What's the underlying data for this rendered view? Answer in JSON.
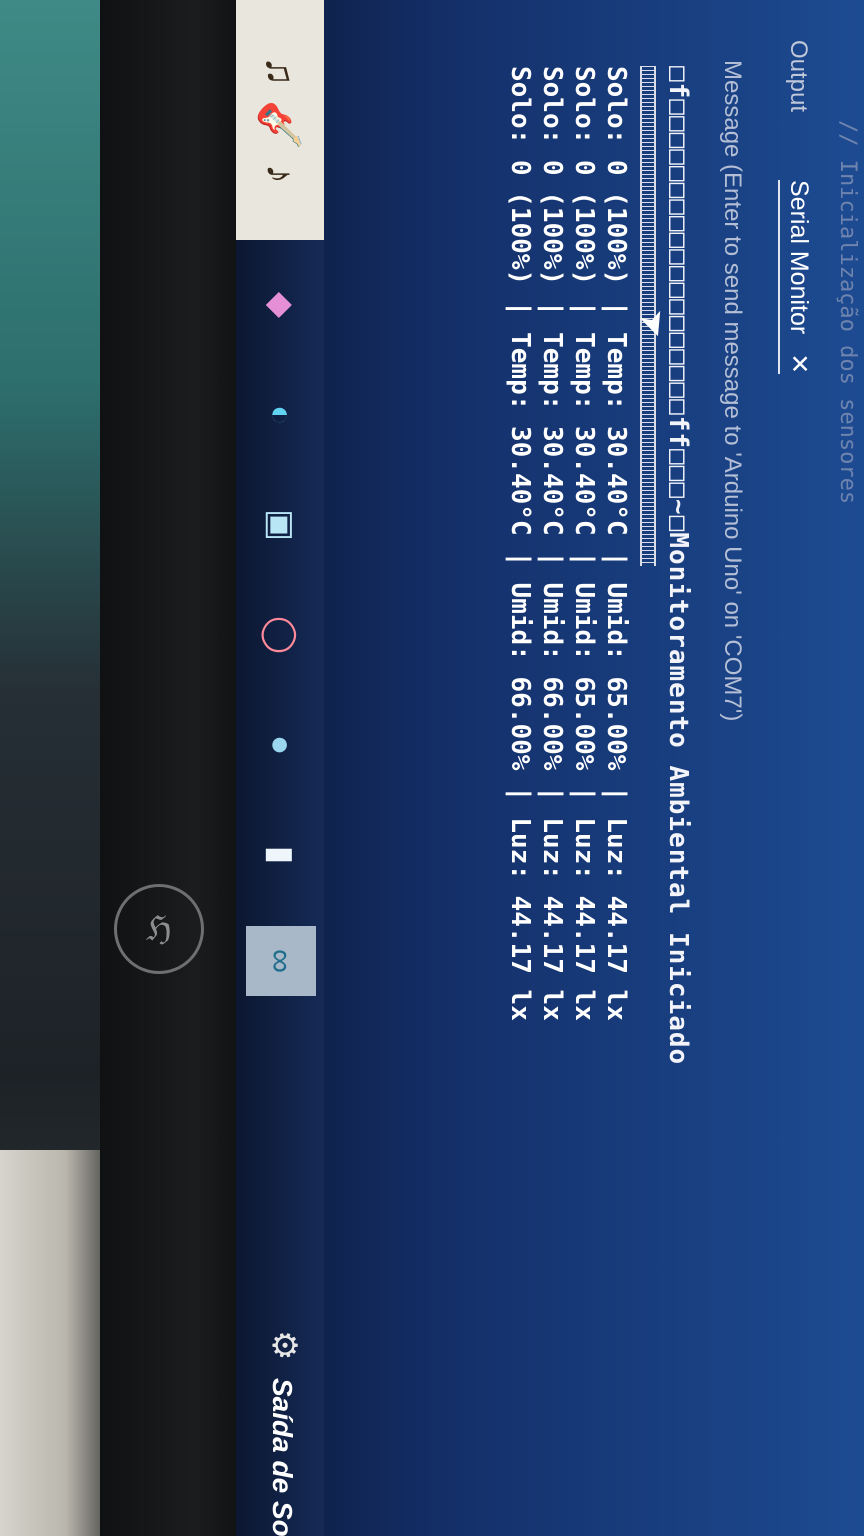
{
  "editor": {
    "code_comment": "// Inicialização dos sensores"
  },
  "panel": {
    "tabs": [
      {
        "label": "Output"
      },
      {
        "label": "Serial Monitor"
      }
    ],
    "close_symbol": "✕",
    "message_placeholder": "Message (Enter to send message to 'Arduino Uno' on 'COM7')"
  },
  "serial": {
    "garbled_header": "□f□□□□□□□□□□□□□□□□□□□ff□□□~□Monitoramento Ambiental Iniciado",
    "lines": [
      "Solo: 0 (100%) | Temp: 30.40°C | Umid: 65.00% | Luz: 44.17 lx",
      "Solo: 0 (100%) | Temp: 30.40°C | Umid: 65.00% | Luz: 44.17 lx",
      "Solo: 0 (100%) | Temp: 30.40°C | Umid: 66.00% | Luz: 44.17 lx",
      "Solo: 0 (100%) | Temp: 30.40°C | Umid: 66.00% | Luz: 44.17 lx"
    ]
  },
  "taskbar": {
    "tray_label": "Saída de Son",
    "icons": [
      {
        "name": "music-app-icon",
        "glyph": "♪"
      },
      {
        "name": "copilot-icon",
        "glyph": "◆"
      },
      {
        "name": "edge-icon",
        "glyph": "◐"
      },
      {
        "name": "store-icon",
        "glyph": "▣"
      },
      {
        "name": "opera-icon",
        "glyph": "◯"
      },
      {
        "name": "chrome-icon",
        "glyph": "●"
      },
      {
        "name": "file-explorer-icon",
        "glyph": "▮"
      },
      {
        "name": "arduino-icon",
        "glyph": "∞"
      }
    ]
  },
  "colors": {
    "screen_bg": "#14306a",
    "text": "#ffffff"
  }
}
